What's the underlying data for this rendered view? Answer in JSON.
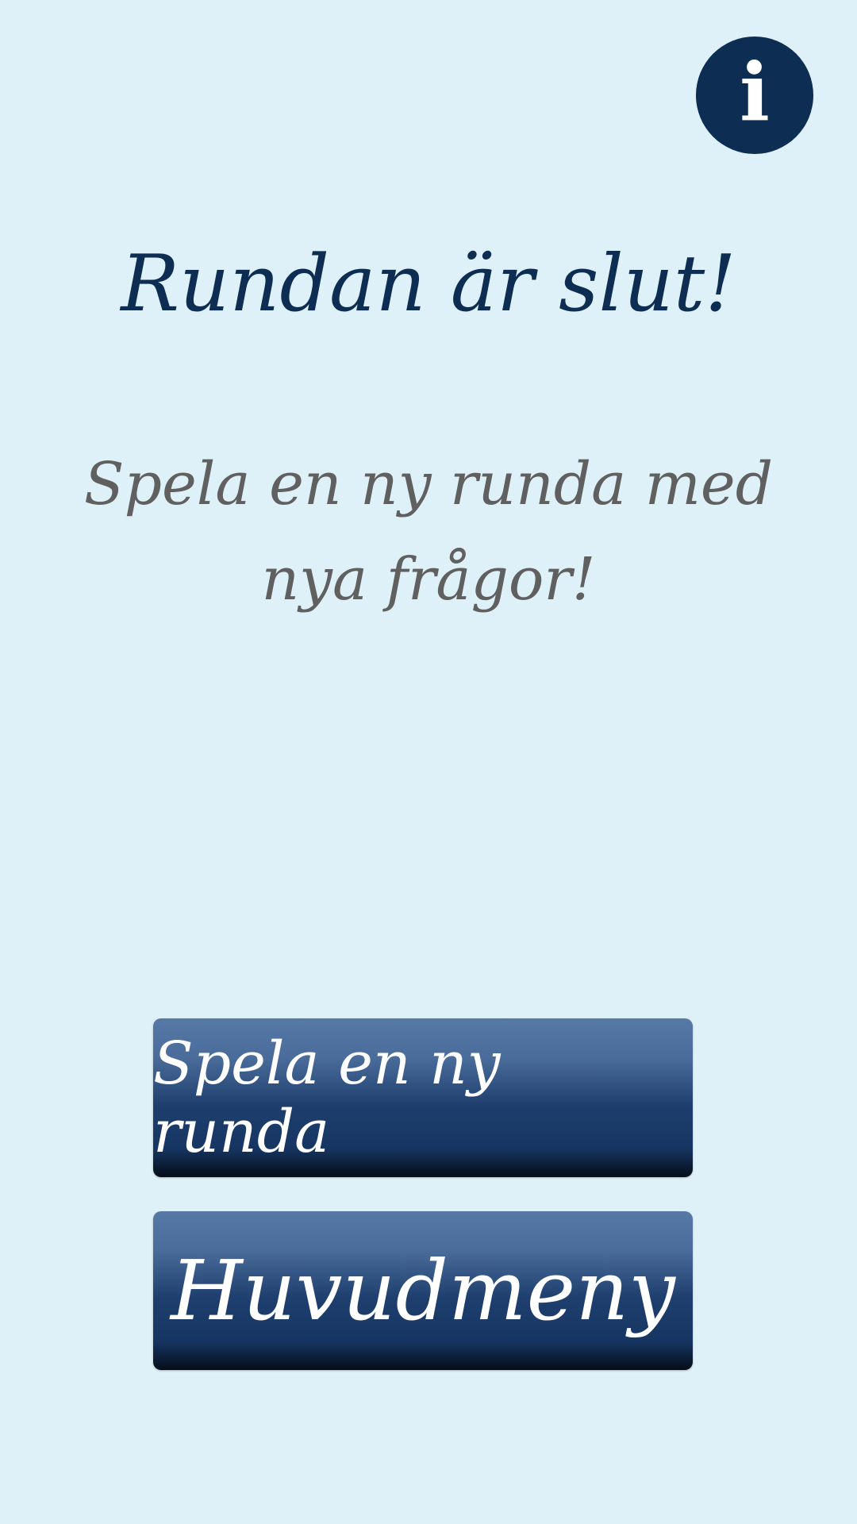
{
  "header": {
    "info_label": "i"
  },
  "main": {
    "title": "Rundan är slut!",
    "subtitle": "Spela en ny runda med nya frågor!"
  },
  "actions": {
    "play_again_label": "Spela en ny runda",
    "main_menu_label": "Huvudmeny"
  },
  "colors": {
    "background": "#dff1f8",
    "primary": "#0e2d52",
    "subtitle": "#606060",
    "button_text": "#ffffff"
  }
}
